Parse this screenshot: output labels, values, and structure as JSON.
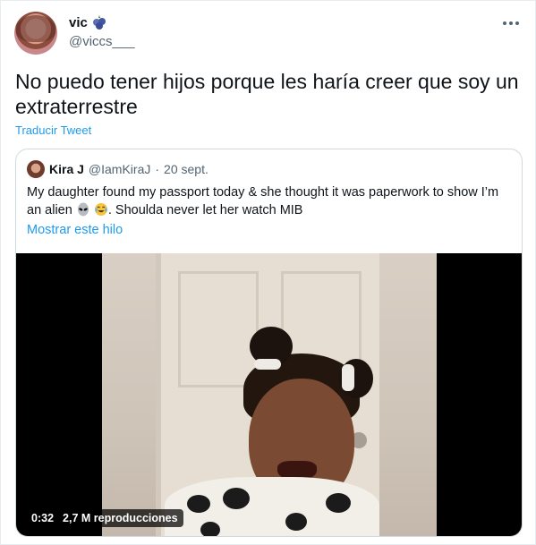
{
  "user": {
    "name": "vic",
    "handle": "@viccs___",
    "badge_icon": "blueberries-icon"
  },
  "tweet": {
    "text": "No puedo tener hijos porque les haría creer que soy un extraterrestre",
    "translate_label": "Traducir Tweet"
  },
  "quoted": {
    "name": "Kira J",
    "handle": "@IamKiraJ",
    "separator": "·",
    "date": "20 sept.",
    "text_part1": "My daughter found my passport today & she thought it was paperwork to show I’m an alien ",
    "text_part2": ". Shoulda never let her watch MIB",
    "emojis": [
      "alien-face-icon",
      "tears-of-joy-icon"
    ],
    "show_thread": "Mostrar este hilo"
  },
  "video": {
    "duration": "0:32",
    "views": "2,7 M reproducciones"
  },
  "colors": {
    "link": "#1d9bf0",
    "secondary": "#536471",
    "border": "#cfd9de"
  }
}
